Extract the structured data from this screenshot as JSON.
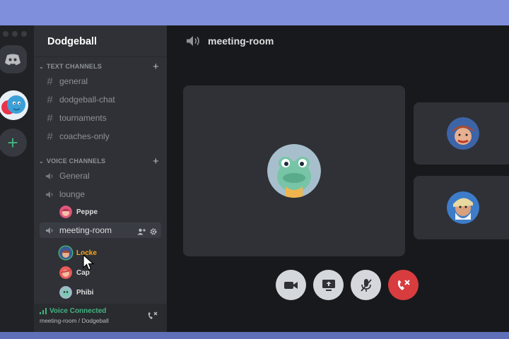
{
  "server": {
    "name": "Dodgeball"
  },
  "categories": {
    "text": "TEXT CHANNELS",
    "voice": "VOICE CHANNELS"
  },
  "text_channels": [
    {
      "label": "general"
    },
    {
      "label": "dodgeball-chat"
    },
    {
      "label": "tournaments"
    },
    {
      "label": "coaches-only"
    }
  ],
  "voice_channels": [
    {
      "label": "General"
    },
    {
      "label": "lounge"
    },
    {
      "label": "meeting-room"
    }
  ],
  "lounge_members": [
    {
      "name": "Peppe"
    }
  ],
  "meeting_members": [
    {
      "name": "Locke",
      "color": "#faa61a"
    },
    {
      "name": "Cap"
    },
    {
      "name": "Phibi"
    }
  ],
  "voice_panel": {
    "status": "Voice Connected",
    "subtitle": "meeting-room / Dodgeball"
  },
  "main": {
    "title": "meeting-room"
  },
  "icons": [
    "discord-home-icon",
    "add-server-icon",
    "hash-icon",
    "speaker-icon",
    "add-user-icon",
    "gear-icon",
    "signal-icon",
    "disconnect-icon",
    "camera-icon",
    "screen-share-icon",
    "mute-mic-icon",
    "leave-call-icon"
  ],
  "colors": {
    "accent": "#7289da",
    "online": "#43b581",
    "danger": "#d83c3e",
    "speaking": "#faa61a"
  }
}
